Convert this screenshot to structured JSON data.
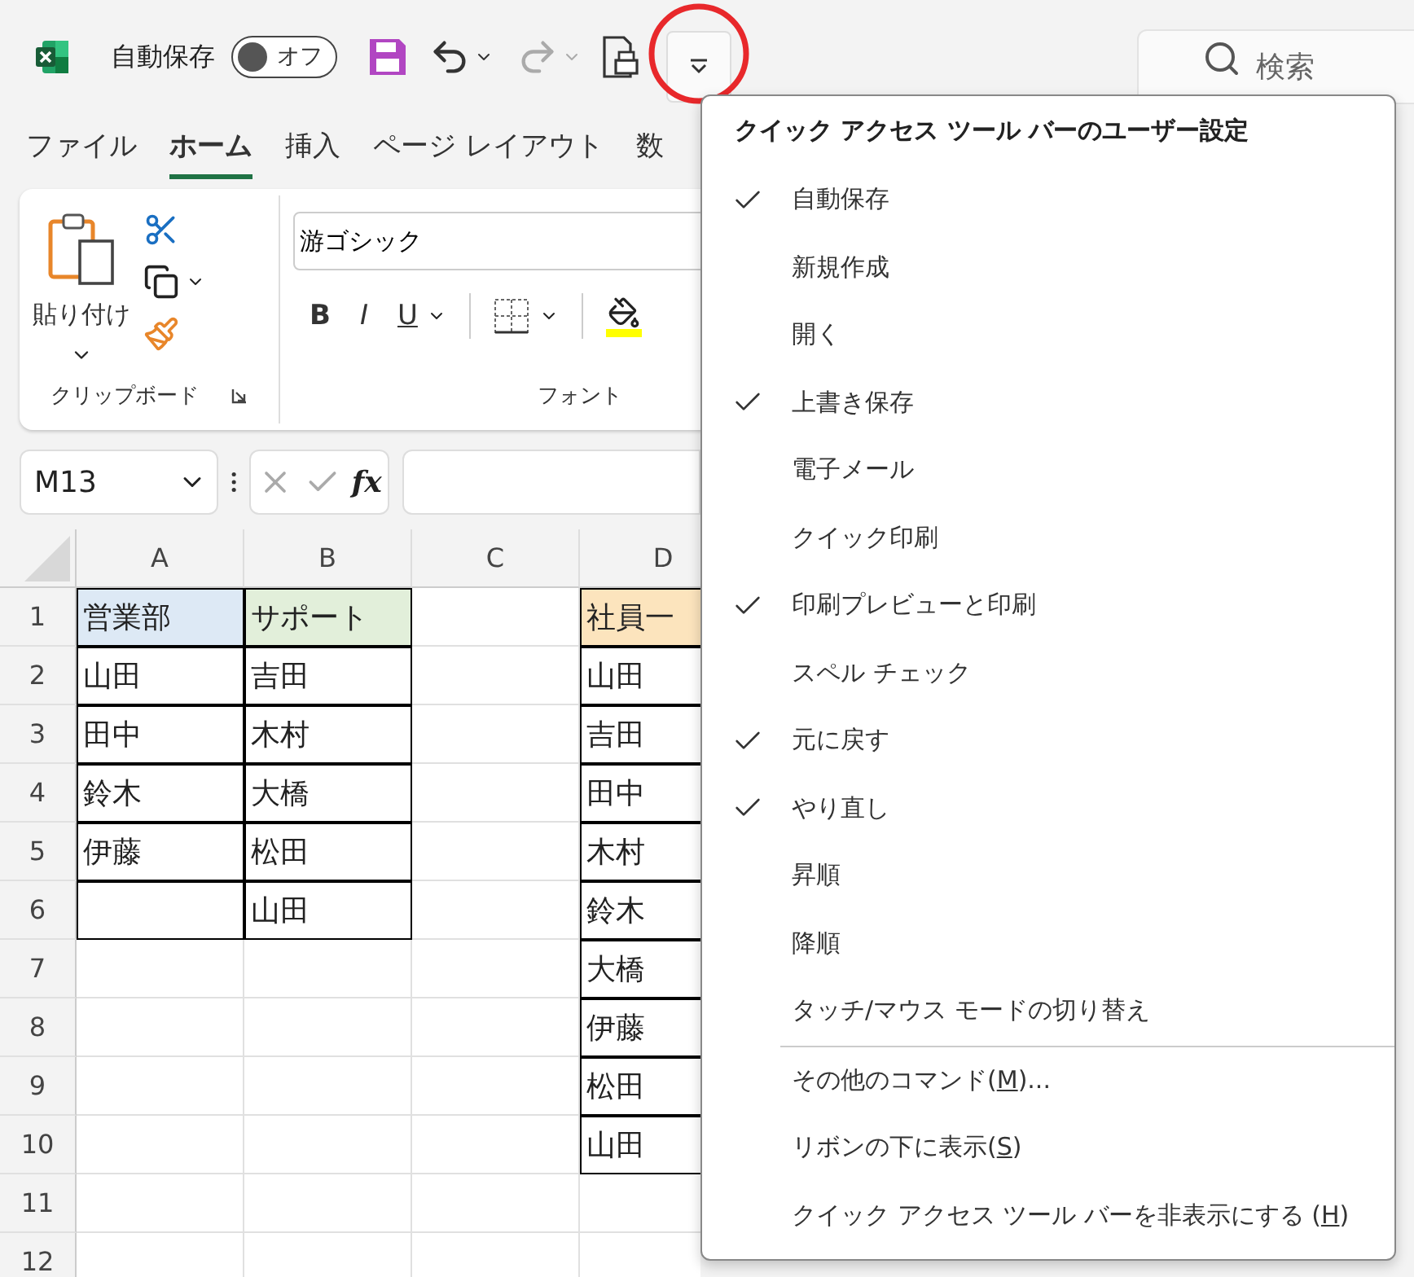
{
  "title_bar": {
    "autosave_label": "自動保存",
    "autosave_toggle": {
      "text": "オフ",
      "on": false
    },
    "undo_disabled": false,
    "redo_disabled": true,
    "customize_highlighted": true,
    "search": {
      "placeholder": "検索"
    }
  },
  "tabs": [
    {
      "label": "ファイル",
      "selected": false
    },
    {
      "label": "ホーム",
      "selected": true
    },
    {
      "label": "挿入",
      "selected": false
    },
    {
      "label": "ページ レイアウト",
      "selected": false
    },
    {
      "label": "数",
      "selected": false
    }
  ],
  "ribbon": {
    "clipboard": {
      "paste_label": "貼り付け",
      "group_label": "クリップボード"
    },
    "font": {
      "font_name": "游ゴシック",
      "bold": "B",
      "italic": "I",
      "underline": "U",
      "group_label": "フォント"
    }
  },
  "formula_bar": {
    "name_box": "M13",
    "fx": "fx"
  },
  "sheet": {
    "columns": [
      "A",
      "B",
      "C",
      "D"
    ],
    "rows": [
      {
        "header": "1",
        "cells": [
          {
            "text": "営業部",
            "color": "#dde9f5",
            "bordered": true
          },
          {
            "text": "サポート",
            "color": "#e2efda",
            "bordered": true
          },
          {
            "bordered": false
          },
          {
            "text": "社員一",
            "color": "#fce4bd",
            "bordered": true
          }
        ]
      },
      {
        "header": "2",
        "cells": [
          {
            "text": "山田",
            "bordered": true
          },
          {
            "text": "吉田",
            "bordered": true
          },
          {
            "bordered": false
          },
          {
            "text": "山田",
            "bordered": true
          }
        ]
      },
      {
        "header": "3",
        "cells": [
          {
            "text": "田中",
            "bordered": true
          },
          {
            "text": "木村",
            "bordered": true
          },
          {
            "bordered": false
          },
          {
            "text": "吉田",
            "bordered": true
          }
        ]
      },
      {
        "header": "4",
        "cells": [
          {
            "text": "鈴木",
            "bordered": true
          },
          {
            "text": "大橋",
            "bordered": true
          },
          {
            "bordered": false
          },
          {
            "text": "田中",
            "bordered": true
          }
        ]
      },
      {
        "header": "5",
        "cells": [
          {
            "text": "伊藤",
            "bordered": true
          },
          {
            "text": "松田",
            "bordered": true
          },
          {
            "bordered": false
          },
          {
            "text": "木村",
            "bordered": true
          }
        ]
      },
      {
        "header": "6",
        "cells": [
          {
            "bordered": true
          },
          {
            "text": "山田",
            "bordered": true
          },
          {
            "bordered": false
          },
          {
            "text": "鈴木",
            "bordered": true
          }
        ]
      },
      {
        "header": "7",
        "cells": [
          {
            "bordered": false
          },
          {
            "bordered": false
          },
          {
            "bordered": false
          },
          {
            "text": "大橋",
            "bordered": true
          }
        ]
      },
      {
        "header": "8",
        "cells": [
          {
            "bordered": false
          },
          {
            "bordered": false
          },
          {
            "bordered": false
          },
          {
            "text": "伊藤",
            "bordered": true
          }
        ]
      },
      {
        "header": "9",
        "cells": [
          {
            "bordered": false
          },
          {
            "bordered": false
          },
          {
            "bordered": false
          },
          {
            "text": "松田",
            "bordered": true
          }
        ]
      },
      {
        "header": "10",
        "cells": [
          {
            "bordered": false
          },
          {
            "bordered": false
          },
          {
            "bordered": false
          },
          {
            "text": "山田",
            "bordered": true
          }
        ]
      },
      {
        "header": "11",
        "cells": [
          {
            "bordered": false
          },
          {
            "bordered": false
          },
          {
            "bordered": false
          },
          {
            "bordered": false
          }
        ]
      },
      {
        "header": "12",
        "cells": [
          {
            "bordered": false
          },
          {
            "bordered": false
          },
          {
            "bordered": false
          },
          {
            "bordered": false
          }
        ]
      }
    ]
  },
  "qat_menu": {
    "title": "クイック アクセス ツール バーのユーザー設定",
    "items": [
      {
        "label": "自動保存",
        "checked": true
      },
      {
        "label": "新規作成",
        "checked": false
      },
      {
        "label": "開く",
        "checked": false
      },
      {
        "label": "上書き保存",
        "checked": true
      },
      {
        "label": "電子メール",
        "checked": false
      },
      {
        "label": "クイック印刷",
        "checked": false
      },
      {
        "label": "印刷プレビューと印刷",
        "checked": true
      },
      {
        "label": "スペル チェック",
        "checked": false
      },
      {
        "label": "元に戻す",
        "checked": true
      },
      {
        "label": "やり直し",
        "checked": true
      },
      {
        "label": "昇順",
        "checked": false
      },
      {
        "label": "降順",
        "checked": false
      },
      {
        "label": "タッチ/マウス モードの切り替え",
        "checked": false
      }
    ],
    "commands": [
      {
        "parts": [
          "その他のコマンド(",
          "M",
          ")..."
        ]
      },
      {
        "parts": [
          "リボンの下に表示(",
          "S",
          ")"
        ]
      },
      {
        "parts": [
          "クイック アクセス ツール バーを非表示にする (",
          "H",
          ")"
        ]
      }
    ]
  }
}
